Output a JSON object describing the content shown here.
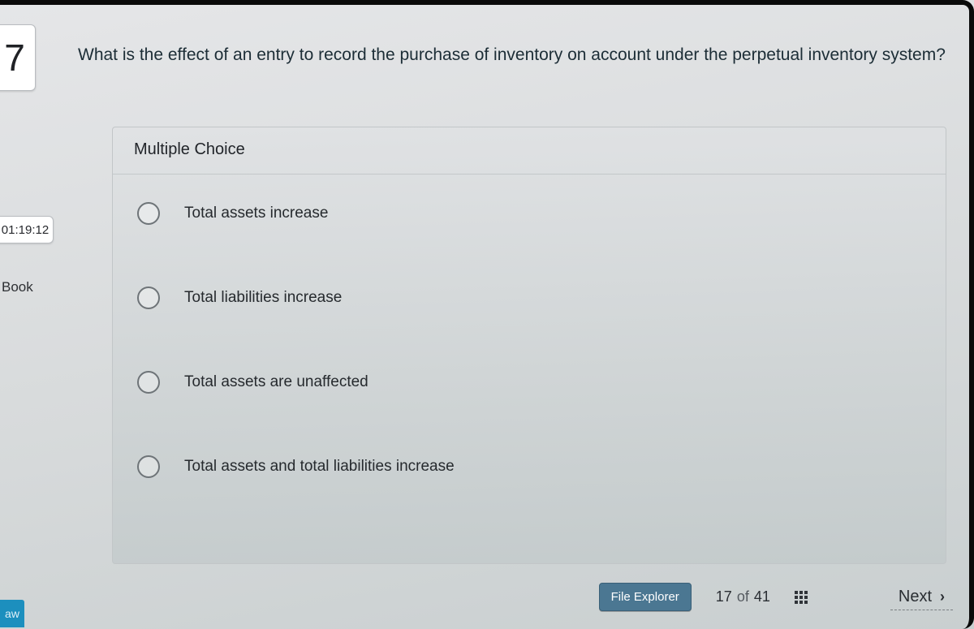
{
  "question_number": "7",
  "timer": "01:19:12",
  "sidebar": {
    "book_label": "Book",
    "aw_label": "aw"
  },
  "question_text": "What is the effect of an entry to record the purchase of inventory on account under the perpetual inventory system?",
  "section_title": "Multiple Choice",
  "options": [
    {
      "label": "Total assets increase"
    },
    {
      "label": "Total liabilities increase"
    },
    {
      "label": "Total assets are unaffected"
    },
    {
      "label": "Total assets and total liabilities increase"
    }
  ],
  "footer": {
    "file_explorer_label": "File Explorer",
    "progress_current": "17",
    "progress_of": "of",
    "progress_total": "41",
    "next_label": "Next"
  }
}
